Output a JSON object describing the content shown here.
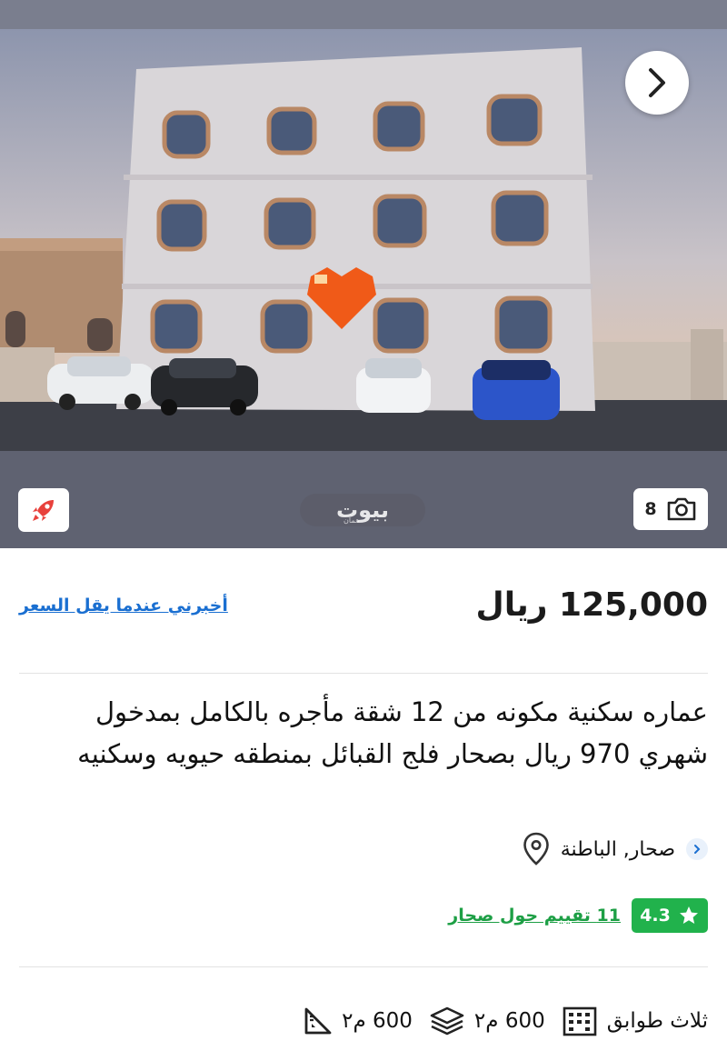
{
  "gallery": {
    "photo_count": "8",
    "watermark_brand": "بيوت",
    "watermark_sub": "عمان",
    "photo_alt": "residential-building-photo"
  },
  "icons": {
    "next": "chevron-right-icon",
    "boost": "rocket-icon",
    "camera": "camera-icon",
    "location": "location-pin-icon",
    "star": "star-icon",
    "area": "ruler-triangle-icon",
    "layers": "layers-icon",
    "building": "building-icon"
  },
  "listing": {
    "price": "125,000 ريال",
    "notify_link": "أخبرني عندما يقل السعر",
    "title": "عماره سكنية مكونه من 12 شقة مأجره بالكامل بمدخول شهري 970 ريال بصحار فلج القبائل بمنطقه حيويه وسكنيه",
    "location": "صحار, الباطنة",
    "rating_value": "4.3",
    "rating_link": "11 تقييم حول صحار"
  },
  "specs": {
    "land_area": "600 م٢",
    "built_area": "600 م٢",
    "floors": "ثلاث طوابق"
  },
  "colors": {
    "link_blue": "#1a6fd1",
    "rating_green": "#21b24c",
    "rating_link_green": "#1d9f45",
    "boost_red": "#e8413c"
  }
}
